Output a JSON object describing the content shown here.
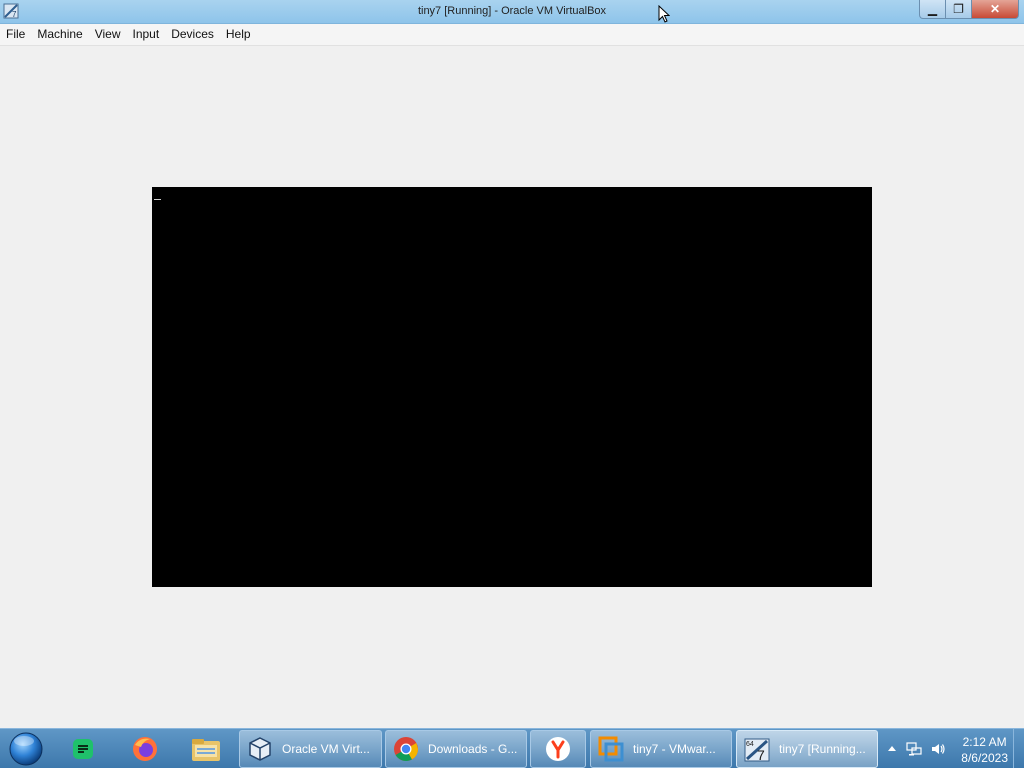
{
  "window": {
    "title": "tiny7 [Running] - Oracle VM VirtualBox",
    "minimize_icon": "minimize-icon",
    "maximize_icon": "restore-icon",
    "close_icon": "close-icon",
    "minimize_glyph": "▁",
    "maximize_glyph": "❐",
    "close_glyph": "✕"
  },
  "menu": {
    "items": [
      "File",
      "Machine",
      "View",
      "Input",
      "Devices",
      "Help"
    ]
  },
  "vm": {
    "screen_color": "#000000",
    "cursor_glyph": "_"
  },
  "taskbar": {
    "start_icon": "windows-start-orb-icon",
    "pinned": [
      {
        "name": "notes-app-icon"
      },
      {
        "name": "firefox-icon"
      },
      {
        "name": "file-explorer-icon"
      }
    ],
    "buttons": [
      {
        "label": "Oracle VM Virt...",
        "icon": "virtualbox-icon"
      },
      {
        "label": "Downloads - G...",
        "icon": "chrome-icon"
      },
      {
        "label": "",
        "icon": "yandex-icon"
      },
      {
        "label": "tiny7 - VMwar...",
        "icon": "vmware-icon"
      },
      {
        "label": "tiny7 [Running...",
        "icon": "virtualbox-vm-icon",
        "badge_top": "64",
        "badge_num": "7"
      }
    ],
    "tray": {
      "icons": [
        "show-hidden-icons-arrow-icon",
        "network-icon",
        "volume-icon"
      ],
      "time": "2:12 AM",
      "date": "8/6/2023"
    }
  },
  "colors": {
    "titlebar": "#9ccbec",
    "taskbar": "#4a84b8",
    "background": "#f0f0f0"
  }
}
